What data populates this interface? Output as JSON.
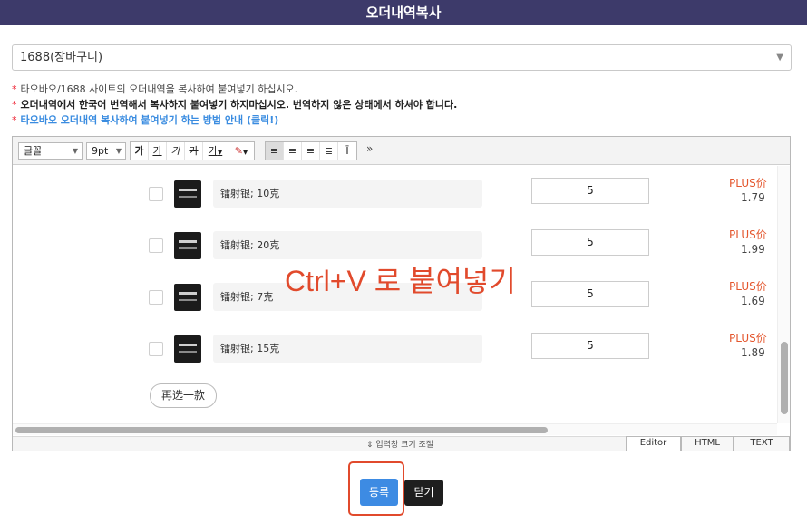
{
  "title": "오더내역복사",
  "source_select": {
    "value": "1688(장바구니)"
  },
  "notes": [
    "타오바오/1688 사이트의 오더내역을 복사하여 붙여넣기 하십시오.",
    "오더내역에서 한국어 번역해서 복사하지 붙여넣기 하지마십시오. 번역하지 않은 상태에서 하셔야 합니다.",
    "타오바오 오더내역 복사하여 붙여넣기 하는 방법 안내 (클릭!)"
  ],
  "toolbar": {
    "font_family": "글꼴",
    "font_size": "9pt",
    "bold": "가",
    "underline": "가",
    "italic": "가",
    "strike": "가",
    "text_color": "가",
    "more": "»"
  },
  "items": [
    {
      "name": "镭射银; 10克",
      "qty": "5",
      "price_label": "PLUS价",
      "price": "1.79"
    },
    {
      "name": "镭射银; 20克",
      "qty": "5",
      "price_label": "PLUS价",
      "price": "1.99"
    },
    {
      "name": "镭射银; 7克",
      "qty": "5",
      "price_label": "PLUS价",
      "price": "1.69"
    },
    {
      "name": "镭射银; 15克",
      "qty": "5",
      "price_label": "PLUS价",
      "price": "1.89"
    }
  ],
  "reselect_label": "再选一款",
  "overlay_hint": "Ctrl+V 로 붙여넣기",
  "resize_label": "⇕ 입력창 크기 조절",
  "mode_tabs": [
    "Editor",
    "HTML",
    "TEXT"
  ],
  "buttons": {
    "register": "등록",
    "close": "닫기"
  },
  "colors": {
    "titlebar": "#3d3a6a",
    "register": "#3d8be3",
    "hint": "#e14a2c",
    "plus_price": "#e4572e"
  }
}
